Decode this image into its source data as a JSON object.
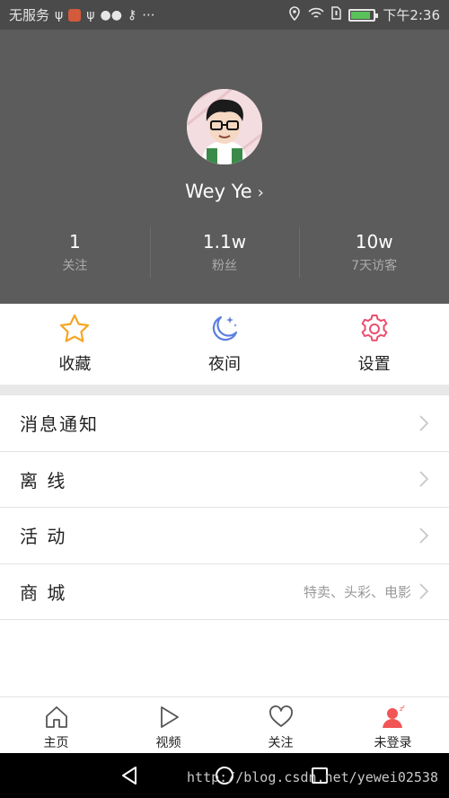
{
  "status_bar": {
    "carrier": "无服务",
    "more": "···",
    "time": "下午2:36",
    "battery_level": 0.85
  },
  "profile": {
    "username": "Wey Ye",
    "chevron": "›",
    "stats": [
      {
        "value": "1",
        "label": "关注"
      },
      {
        "value": "1.1w",
        "label": "粉丝"
      },
      {
        "value": "10w",
        "label": "7天访客"
      }
    ]
  },
  "actions": [
    {
      "label": "收藏",
      "icon": "star-icon",
      "color": "#f5a623"
    },
    {
      "label": "夜间",
      "icon": "moon-icon",
      "color": "#5b7ee0"
    },
    {
      "label": "设置",
      "icon": "gear-icon",
      "color": "#e8506e"
    }
  ],
  "menu": [
    {
      "label": "消息通知",
      "extra": ""
    },
    {
      "label": "离 线",
      "extra": ""
    },
    {
      "label": "活 动",
      "extra": ""
    },
    {
      "label": "商 城",
      "extra": "特卖、头彩、电影"
    }
  ],
  "bottom_nav": [
    {
      "label": "主页",
      "icon": "home-icon"
    },
    {
      "label": "视频",
      "icon": "play-icon"
    },
    {
      "label": "关注",
      "icon": "heart-icon"
    },
    {
      "label": "未登录",
      "icon": "user-icon",
      "color": "#f25555"
    }
  ],
  "watermark": "http://blog.csdn.net/yewei02538"
}
